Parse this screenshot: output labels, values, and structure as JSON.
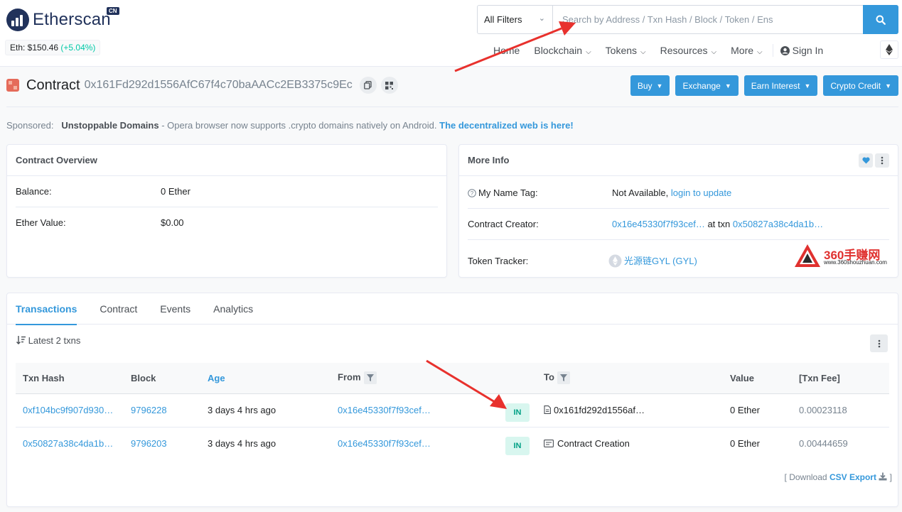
{
  "header": {
    "logo_text": "Etherscan",
    "logo_badge": "CN",
    "eth_price_label": "Eth: $150.46",
    "eth_price_change": "(+5.04%)",
    "filter_label": "All Filters",
    "search_placeholder": "Search by Address / Txn Hash / Block / Token / Ens",
    "nav": [
      {
        "label": "Home"
      },
      {
        "label": "Blockchain"
      },
      {
        "label": "Tokens"
      },
      {
        "label": "Resources"
      },
      {
        "label": "More"
      }
    ],
    "signin_label": "Sign In"
  },
  "contract": {
    "label": "Contract",
    "address": "0x161Fd292d1556AfC67f4c70baAACc2EB3375c9Ec",
    "buttons": [
      "Buy",
      "Exchange",
      "Earn Interest",
      "Crypto Credit"
    ]
  },
  "sponsored": {
    "prefix": "Sponsored:",
    "name": "Unstoppable Domains",
    "text": " - Opera browser now supports .crypto domains natively on Android.",
    "link": "The decentralized web is here!"
  },
  "overview": {
    "title": "Contract Overview",
    "balance_label": "Balance:",
    "balance_value": "0 Ether",
    "ether_value_label": "Ether Value:",
    "ether_value_value": "$0.00"
  },
  "more_info": {
    "title": "More Info",
    "name_tag_label": "My Name Tag:",
    "name_tag_value": "Not Available,",
    "name_tag_link": "login to update",
    "creator_label": "Contract Creator:",
    "creator_addr": "0x16e45330f7f93cef…",
    "creator_at": "at txn",
    "creator_txn": "0x50827a38c4da1b…",
    "token_tracker_label": "Token Tracker:",
    "token_tracker_value": "光源链GYL (GYL)"
  },
  "tabs": [
    "Transactions",
    "Contract",
    "Events",
    "Analytics"
  ],
  "txns": {
    "summary": "Latest 2 txns",
    "columns": [
      "Txn Hash",
      "Block",
      "Age",
      "From",
      "",
      "To",
      "Value",
      "[Txn Fee]"
    ],
    "rows": [
      {
        "hash": "0xf104bc9f907d930…",
        "block": "9796228",
        "age": "3 days 4 hrs ago",
        "from": "0x16e45330f7f93cef…",
        "dir": "IN",
        "to": "0x161fd292d1556af…",
        "value": "0 Ether",
        "fee": "0.00023118"
      },
      {
        "hash": "0x50827a38c4da1b…",
        "block": "9796203",
        "age": "3 days 4 hrs ago",
        "from": "0x16e45330f7f93cef…",
        "dir": "IN",
        "to": "Contract Creation",
        "value": "0 Ether",
        "fee": "0.00444659"
      }
    ],
    "download_prefix": "[ Download",
    "download_c": "C",
    "download_link": "SV Export",
    "download_suffix": "]"
  },
  "watermark": {
    "text": "360手赚网",
    "url": "www.360shouzhuan.com"
  },
  "colors": {
    "accent": "#3498db",
    "positive": "#00c9a7",
    "annotation_arrow": "#e8312d"
  }
}
